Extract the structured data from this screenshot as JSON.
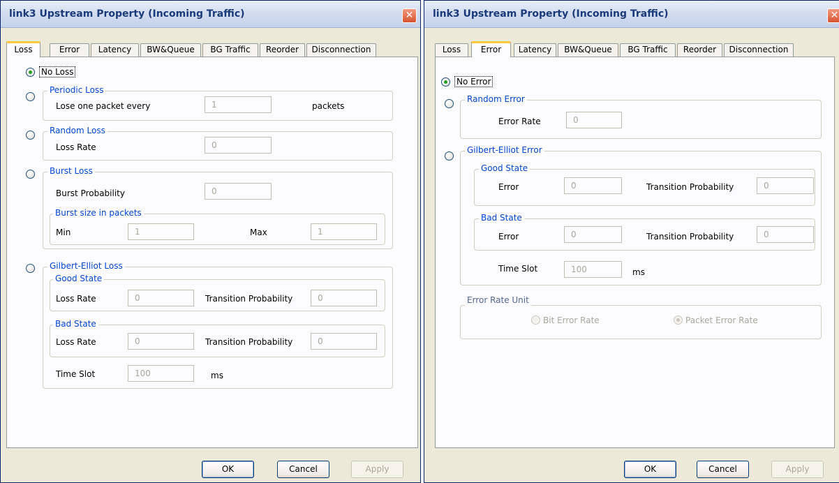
{
  "left_dialog": {
    "title": "link3 Upstream Property (Incoming Traffic)",
    "tabs": [
      {
        "label": "Loss",
        "active": true
      },
      {
        "label": "Error",
        "active": false
      },
      {
        "label": "Latency",
        "active": false
      },
      {
        "label": "BW&Queue",
        "active": false
      },
      {
        "label": "BG Traffic",
        "active": false
      },
      {
        "label": "Reorder",
        "active": false
      },
      {
        "label": "Disconnection",
        "active": false
      }
    ],
    "no_loss": {
      "label": "No Loss",
      "selected": true
    },
    "periodic_loss": {
      "legend": "Periodic Loss",
      "label": "Lose one packet every",
      "value": "1",
      "unit": "packets"
    },
    "random_loss": {
      "legend": "Random Loss",
      "label": "Loss Rate",
      "value": "0"
    },
    "burst_loss": {
      "legend": "Burst Loss",
      "prob_label": "Burst Probability",
      "prob_value": "0",
      "size_legend": "Burst size in packets",
      "min_label": "Min",
      "min_value": "1",
      "max_label": "Max",
      "max_value": "1"
    },
    "gilbert_loss": {
      "legend": "Gilbert-Elliot Loss",
      "good_legend": "Good State",
      "good_rate_label": "Loss Rate",
      "good_rate_value": "0",
      "good_tp_label": "Transition Probability",
      "good_tp_value": "0",
      "bad_legend": "Bad State",
      "bad_rate_label": "Loss Rate",
      "bad_rate_value": "0",
      "bad_tp_label": "Transition Probability",
      "bad_tp_value": "0",
      "slot_label": "Time Slot",
      "slot_value": "100",
      "slot_unit": "ms"
    },
    "buttons": {
      "ok": "OK",
      "cancel": "Cancel",
      "apply": "Apply"
    }
  },
  "right_dialog": {
    "title": "link3 Upstream Property (Incoming Traffic)",
    "tabs": [
      {
        "label": "Loss",
        "active": false
      },
      {
        "label": "Error",
        "active": true
      },
      {
        "label": "Latency",
        "active": false
      },
      {
        "label": "BW&Queue",
        "active": false
      },
      {
        "label": "BG Traffic",
        "active": false
      },
      {
        "label": "Reorder",
        "active": false
      },
      {
        "label": "Disconnection",
        "active": false
      }
    ],
    "no_error": {
      "label": "No Error",
      "selected": true
    },
    "random_error": {
      "legend": "Random Error",
      "label": "Error Rate",
      "value": "0"
    },
    "gilbert_error": {
      "legend": "Gilbert-Elliot Error",
      "good_legend": "Good State",
      "good_err_label": "Error",
      "good_err_value": "0",
      "good_tp_label": "Transition Probability",
      "good_tp_value": "0",
      "bad_legend": "Bad State",
      "bad_err_label": "Error",
      "bad_err_value": "0",
      "bad_tp_label": "Transition Probability",
      "bad_tp_value": "0",
      "slot_label": "Time Slot",
      "slot_value": "100",
      "slot_unit": "ms"
    },
    "rate_unit": {
      "legend": "Error Rate Unit",
      "bit_label": "Bit Error Rate",
      "packet_label": "Packet Error Rate",
      "selected": "packet"
    },
    "buttons": {
      "ok": "OK",
      "cancel": "Cancel",
      "apply": "Apply"
    }
  },
  "icons": {
    "close": "close-icon"
  },
  "colors": {
    "title_text": "#1b3a7a",
    "legend_text": "#0046d5",
    "active_tab_accent": "#ffc83c",
    "close_button": "#d8532f",
    "radio_selected": "#21a121"
  }
}
